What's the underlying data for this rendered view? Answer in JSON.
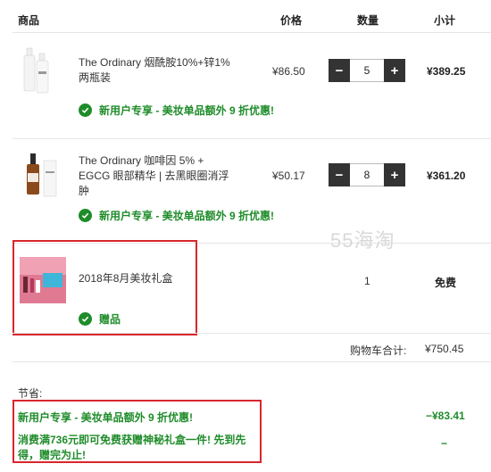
{
  "header": {
    "product": "商品",
    "price": "价格",
    "quantity": "数量",
    "subtotal": "小计"
  },
  "items": [
    {
      "name": "The Ordinary 烟酰胺10%+锌1% 两瓶装",
      "price": "¥86.50",
      "qty": "5",
      "subtotal": "¥389.25",
      "promo": "新用户专享 - 美妆单品额外 9 折优惠!"
    },
    {
      "name": "The Ordinary 咖啡因 5% + EGCG 眼部精华 | 去黑眼圈消浮肿",
      "price": "¥50.17",
      "qty": "8",
      "subtotal": "¥361.20",
      "promo": "新用户专享 - 美妆单品额外 9 折优惠!"
    },
    {
      "name": "2018年8月美妆礼盒",
      "qty": "1",
      "subtotal": "免费",
      "promo": "赠品"
    }
  ],
  "qty_minus": "−",
  "qty_plus": "+",
  "watermark": "55海淘",
  "cart_total": {
    "label": "购物车合计:",
    "value": "¥750.45"
  },
  "savings": {
    "title": "节省:",
    "lines": [
      {
        "text": "新用户专享 - 美妆单品额外 9 折优惠!",
        "value": "−¥83.41"
      },
      {
        "text": "消费满736元即可免费获赠神秘礼盒一件! 先到先得，赠完为止!",
        "value": "−"
      }
    ]
  },
  "colors": {
    "green": "#1f8c2a",
    "red_box": "#d9262b",
    "button": "#333333"
  }
}
